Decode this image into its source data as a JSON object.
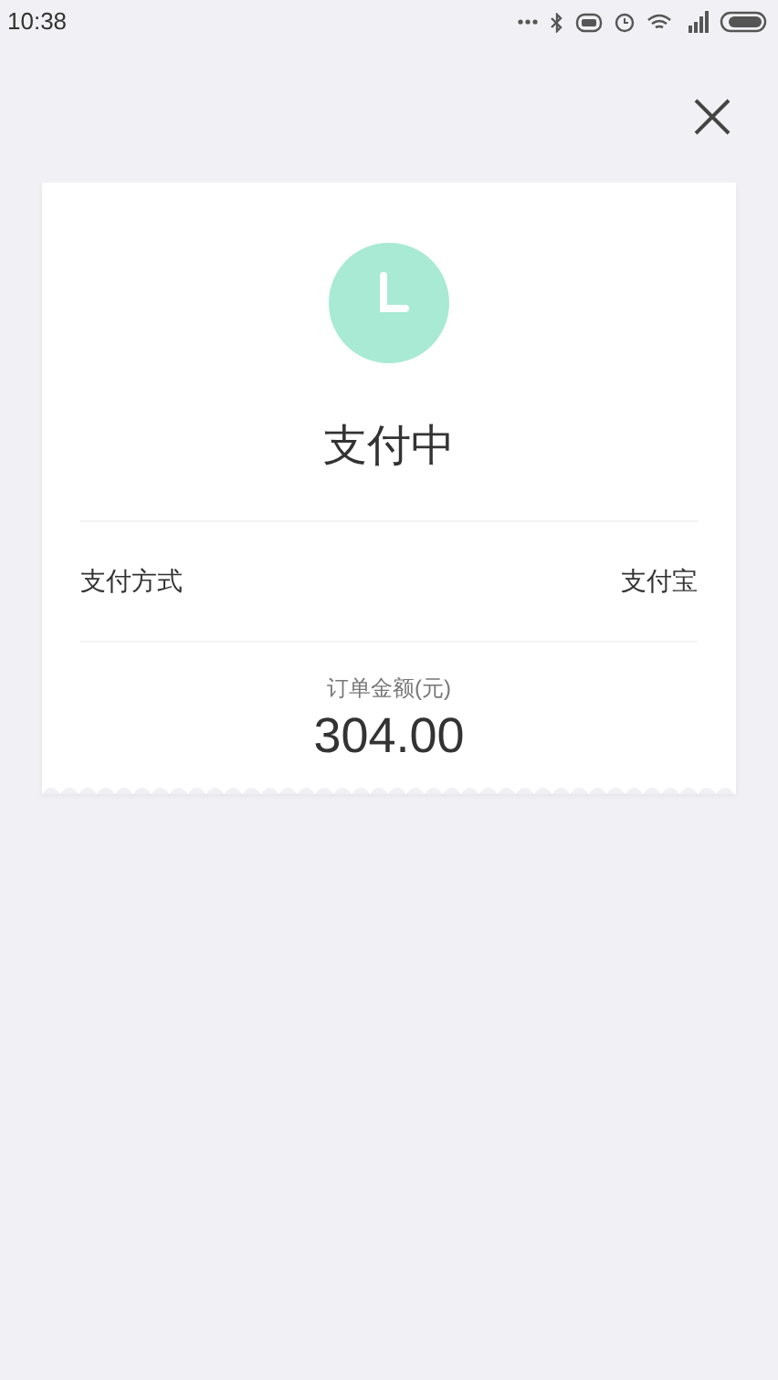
{
  "status_bar": {
    "time": "10:38"
  },
  "card": {
    "title": "支付中",
    "rows": [
      {
        "label": "支付方式",
        "value": "支付宝"
      }
    ],
    "amount_label": "订单金额(元)",
    "amount": "304.00"
  }
}
